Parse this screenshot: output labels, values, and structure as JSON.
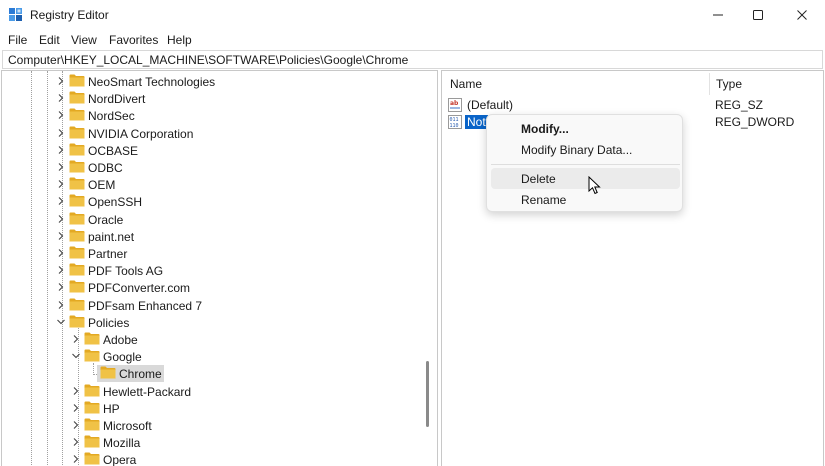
{
  "window": {
    "title": "Registry Editor",
    "icons": {
      "app": "registry-editor-icon",
      "minimize": "minimize-icon",
      "maximize": "maximize-icon",
      "close": "close-icon"
    }
  },
  "menu": [
    "File",
    "Edit",
    "View",
    "Favorites",
    "Help"
  ],
  "address": "Computer\\HKEY_LOCAL_MACHINE\\SOFTWARE\\Policies\\Google\\Chrome",
  "tree": {
    "items": [
      {
        "label": "NeoSmart Technologies",
        "expanded": false,
        "level": 0
      },
      {
        "label": "NordDivert",
        "expanded": false,
        "level": 0
      },
      {
        "label": "NordSec",
        "expanded": false,
        "level": 0
      },
      {
        "label": "NVIDIA Corporation",
        "expanded": false,
        "level": 0
      },
      {
        "label": "OCBASE",
        "expanded": false,
        "level": 0
      },
      {
        "label": "ODBC",
        "expanded": false,
        "level": 0
      },
      {
        "label": "OEM",
        "expanded": false,
        "level": 0
      },
      {
        "label": "OpenSSH",
        "expanded": false,
        "level": 0
      },
      {
        "label": "Oracle",
        "expanded": false,
        "level": 0
      },
      {
        "label": "paint.net",
        "expanded": false,
        "level": 0
      },
      {
        "label": "Partner",
        "expanded": false,
        "level": 0
      },
      {
        "label": "PDF Tools AG",
        "expanded": false,
        "level": 0
      },
      {
        "label": "PDFConverter.com",
        "expanded": false,
        "level": 0
      },
      {
        "label": "PDFsam Enhanced 7",
        "expanded": false,
        "level": 0
      },
      {
        "label": "Policies",
        "expanded": true,
        "level": 0
      },
      {
        "label": "Adobe",
        "expanded": false,
        "level": 1
      },
      {
        "label": "Google",
        "expanded": true,
        "level": 1
      },
      {
        "label": "Chrome",
        "expanded": false,
        "level": 2,
        "selected": true
      },
      {
        "label": "Hewlett-Packard",
        "expanded": false,
        "level": 1
      },
      {
        "label": "HP",
        "expanded": false,
        "level": 1
      },
      {
        "label": "Microsoft",
        "expanded": false,
        "level": 1
      },
      {
        "label": "Mozilla",
        "expanded": false,
        "level": 1
      },
      {
        "label": "Opera",
        "expanded": false,
        "level": 1
      }
    ]
  },
  "values": {
    "headers": {
      "name": "Name",
      "type": "Type"
    },
    "rows": [
      {
        "name": "(Default)",
        "type": "REG_SZ",
        "icon": "string-value-icon",
        "selected": false
      },
      {
        "name": "Not",
        "type": "REG_DWORD",
        "icon": "dword-value-icon",
        "selected": true
      }
    ]
  },
  "context_menu": {
    "items": [
      {
        "label": "Modify...",
        "bold": true
      },
      {
        "label": "Modify Binary Data...",
        "bold": false
      },
      {
        "label": "Delete",
        "bold": false,
        "hover": true
      },
      {
        "label": "Rename",
        "bold": false
      }
    ]
  },
  "colors": {
    "selection": "#0a64c8",
    "folder": "#f0c246",
    "folder_dark": "#e3a923"
  }
}
